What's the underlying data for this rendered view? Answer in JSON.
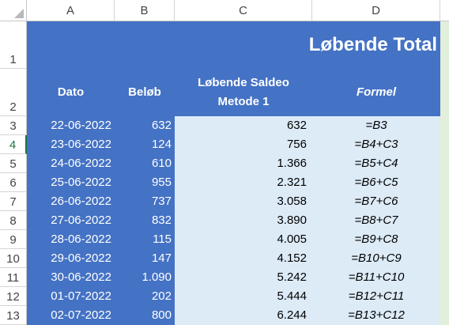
{
  "columns": [
    "A",
    "B",
    "C",
    "D"
  ],
  "title": "Løbende Total",
  "headers": {
    "dato": "Dato",
    "belob": "Beløb",
    "saldeo_line1": "Løbende Saldeo",
    "saldeo_line2": "Metode 1",
    "formel": "Formel"
  },
  "rows": [
    {
      "num": "3",
      "date": "22-06-2022",
      "amount": "632",
      "running": "632",
      "formula": "=B3"
    },
    {
      "num": "4",
      "date": "23-06-2022",
      "amount": "124",
      "running": "756",
      "formula": "=B4+C3"
    },
    {
      "num": "5",
      "date": "24-06-2022",
      "amount": "610",
      "running": "1.366",
      "formula": "=B5+C4"
    },
    {
      "num": "6",
      "date": "25-06-2022",
      "amount": "955",
      "running": "2.321",
      "formula": "=B6+C5"
    },
    {
      "num": "7",
      "date": "26-06-2022",
      "amount": "737",
      "running": "3.058",
      "formula": "=B7+C6"
    },
    {
      "num": "8",
      "date": "27-06-2022",
      "amount": "832",
      "running": "3.890",
      "formula": "=B8+C7"
    },
    {
      "num": "9",
      "date": "28-06-2022",
      "amount": "115",
      "running": "4.005",
      "formula": "=B9+C8"
    },
    {
      "num": "10",
      "date": "29-06-2022",
      "amount": "147",
      "running": "4.152",
      "formula": "=B10+C9"
    },
    {
      "num": "11",
      "date": "30-06-2022",
      "amount": "1.090",
      "running": "5.242",
      "formula": "=B11+C10"
    },
    {
      "num": "12",
      "date": "01-07-2022",
      "amount": "202",
      "running": "5.444",
      "formula": "=B12+C11"
    },
    {
      "num": "13",
      "date": "02-07-2022",
      "amount": "800",
      "running": "6.244",
      "formula": "=B13+C12"
    }
  ],
  "header_rows": [
    "1",
    "2"
  ],
  "colors": {
    "table_blue": "#4472c4",
    "light_blue": "#ddebf7",
    "light_green": "#e2efda",
    "active_row": "#217346"
  }
}
